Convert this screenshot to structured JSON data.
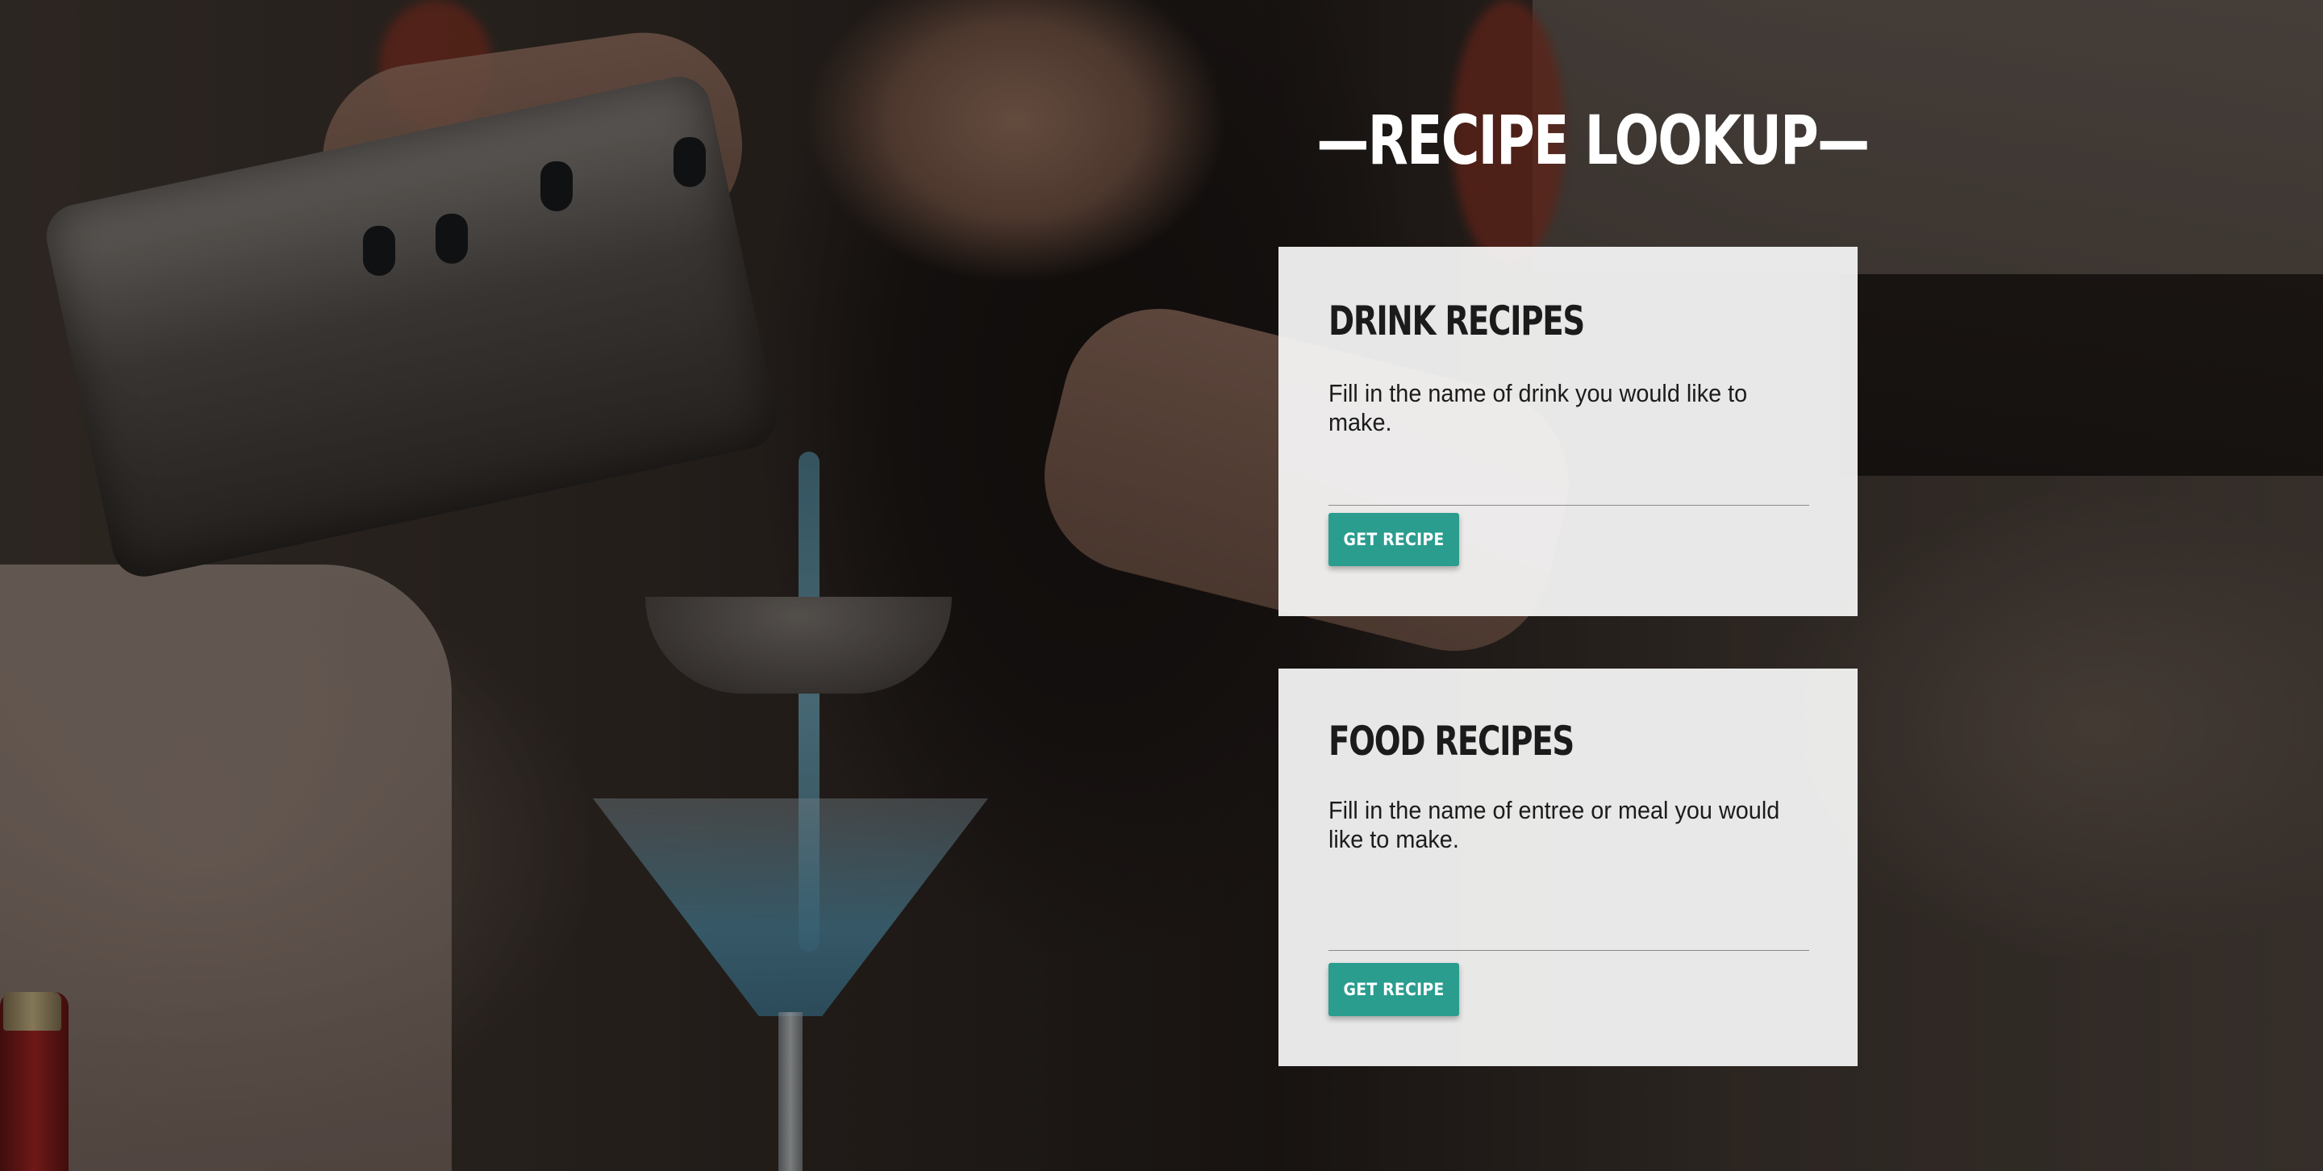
{
  "page": {
    "title": "—RECIPE LOOKUP—"
  },
  "drink": {
    "heading": "DRINK RECIPES",
    "description": "Fill in the name of drink you would like to make.",
    "input_value": "",
    "button_label": "GET RECIPE"
  },
  "food": {
    "heading": "FOOD RECIPES",
    "description": "Fill in the name of entree or meal you would like to make.",
    "input_value": "",
    "button_label": "GET RECIPE"
  },
  "colors": {
    "accent": "#2a9d8f",
    "card_background": "#f8f8f8",
    "title_text": "#ffffff"
  }
}
